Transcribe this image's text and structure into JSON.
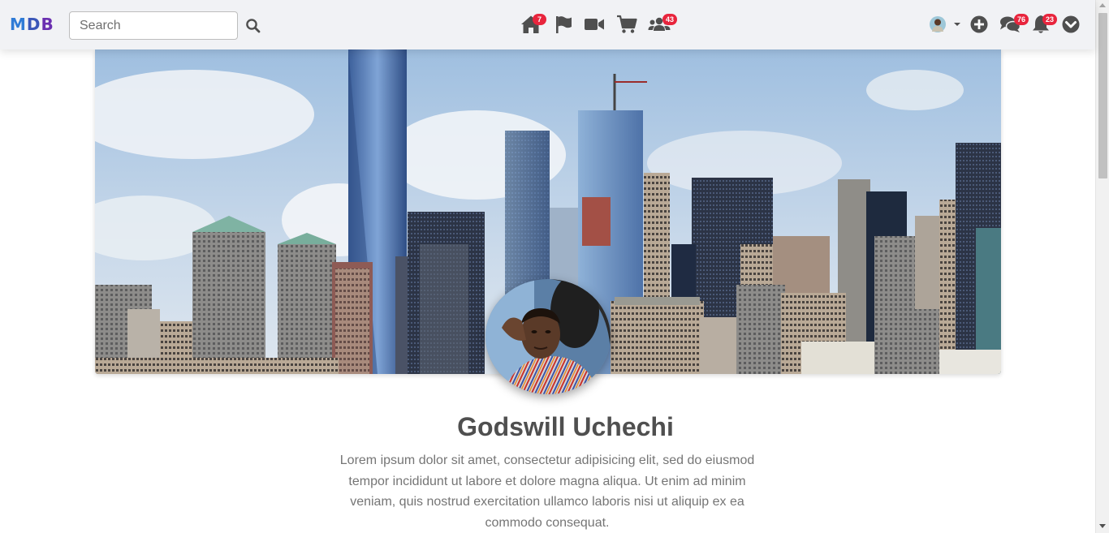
{
  "brand": {
    "letters": [
      "M",
      "D",
      "B"
    ]
  },
  "search": {
    "placeholder": "Search",
    "value": "",
    "icon": "search-icon"
  },
  "nav_center": [
    {
      "icon": "home-icon",
      "badge": "7"
    },
    {
      "icon": "flag-icon",
      "badge": ""
    },
    {
      "icon": "video-icon",
      "badge": ""
    },
    {
      "icon": "cart-icon",
      "badge": ""
    },
    {
      "icon": "users-icon",
      "badge": "43"
    }
  ],
  "nav_right": [
    {
      "icon": "avatar-dropdown",
      "badge": ""
    },
    {
      "icon": "plus-circle-icon",
      "badge": ""
    },
    {
      "icon": "comments-icon",
      "badge": "76"
    },
    {
      "icon": "bell-icon",
      "badge": "23"
    },
    {
      "icon": "chevron-circle-down-icon",
      "badge": ""
    }
  ],
  "profile": {
    "name": "Godswill Uchechi",
    "bio": "Lorem ipsum dolor sit amet, consectetur adipisicing elit, sed do eiusmod tempor incididunt ut labore et dolore magna aliqua. Ut enim ad minim veniam, quis nostrud exercitation ullamco laboris nisi ut aliquip ex ea commodo consequat."
  },
  "colors": {
    "badge": "#e8253d",
    "navbar": "#f1f2f5",
    "icon": "#4f4f4f",
    "brand_blue": "#2f7bd6",
    "brand_purple": "#6a2fb0"
  }
}
